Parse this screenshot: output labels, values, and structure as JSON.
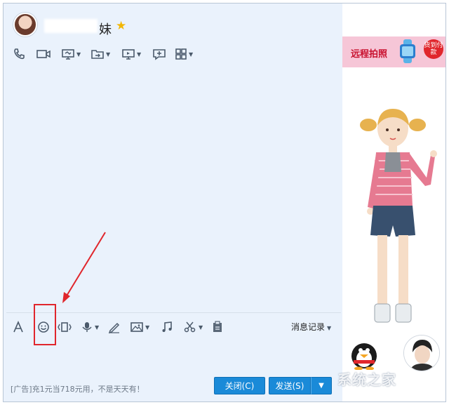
{
  "header": {
    "contact_name": "妹",
    "status_icon": "star-icon"
  },
  "window_controls": [
    "minimize",
    "maximize",
    "close"
  ],
  "top_toolbar": [
    "phone-icon",
    "video-icon",
    "screen-share-icon",
    "file-transfer-icon",
    "remote-desktop-icon",
    "add-app-icon",
    "more-apps-icon"
  ],
  "bottom_toolbar": {
    "tools": [
      "font-icon",
      "emoji-icon",
      "shake-icon",
      "voice-icon",
      "doodle-icon",
      "image-icon",
      "music-icon",
      "screenshot-icon",
      "clipboard-icon"
    ],
    "history_label": "消息记录"
  },
  "footer": {
    "ad_text": "[广告]充1元当718元用，不是天天有！",
    "close_button": "关闭(C)",
    "send_button": "发送(S)"
  },
  "ad_panel": {
    "banner_text": "远程拍照",
    "badge_text": "货到付款"
  },
  "watermark": "系统之家",
  "colors": {
    "accent": "#1a8ad8",
    "annotation": "#e0262c",
    "chat_bg": "#eaf2fc"
  }
}
